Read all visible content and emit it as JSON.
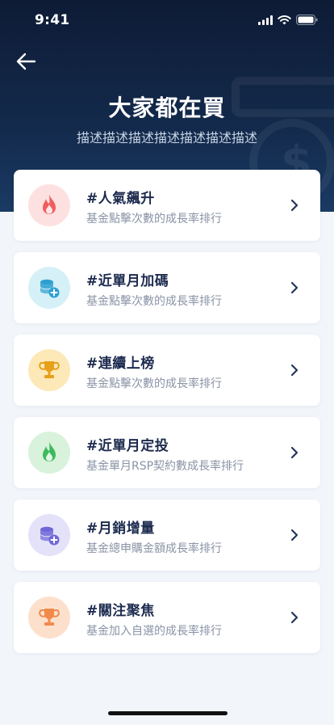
{
  "status_bar": {
    "time": "9:41"
  },
  "header": {
    "title": "大家都在買",
    "subtitle": "描述描述描述描述描述描述描述",
    "back_icon": "arrow-left-icon"
  },
  "colors": {
    "header_dark": "#0e1b35",
    "background": "#f2f5fa",
    "title_text": "#1d2b4f",
    "desc_text": "#8a93a6"
  },
  "cards": [
    {
      "title": "#人氣飆升",
      "desc": "基金點擊次數的成長率排行",
      "icon": "flame-icon",
      "icon_bg": "#fde1e1",
      "icon_color": "#f25c5c"
    },
    {
      "title": "#近單月加碼",
      "desc": "基金點擊次數的成長率排行",
      "icon": "coins-plus-icon",
      "icon_bg": "#d6f0f7",
      "icon_color": "#2d9fd0"
    },
    {
      "title": "#連續上榜",
      "desc": "基金點擊次數的成長率排行",
      "icon": "trophy-icon",
      "icon_bg": "#fde8b8",
      "icon_color": "#e6a01a"
    },
    {
      "title": "#近單月定投",
      "desc": "基金單月RSP契約數成長率排行",
      "icon": "flame-icon",
      "icon_bg": "#d9f2dc",
      "icon_color": "#3dba5c"
    },
    {
      "title": "#月銷增量",
      "desc": "基金總申購金額成長率排行",
      "icon": "coins-plus-icon",
      "icon_bg": "#e4e2f9",
      "icon_color": "#6f66d8"
    },
    {
      "title": "#關注聚焦",
      "desc": "基金加入自選的成長率排行",
      "icon": "trophy-icon",
      "icon_bg": "#fde0cc",
      "icon_color": "#f08a4b"
    }
  ]
}
